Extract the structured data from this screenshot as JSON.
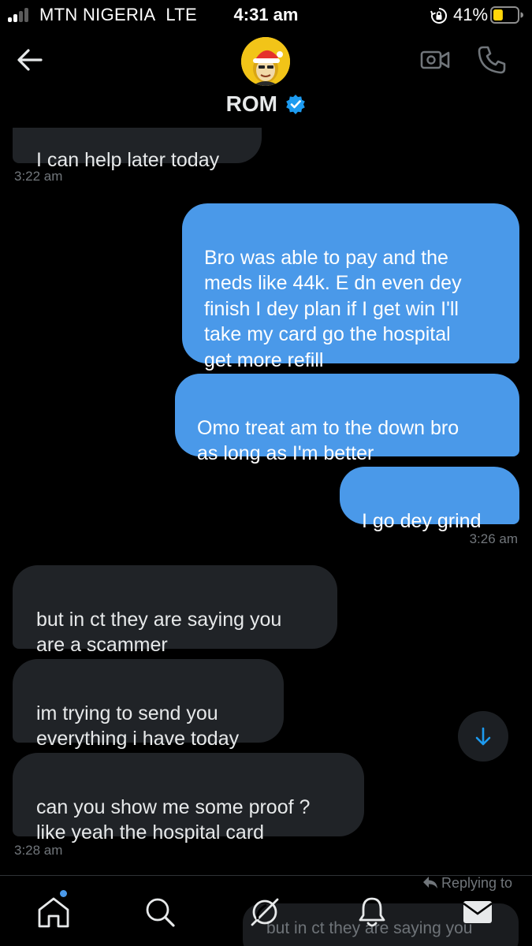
{
  "status_bar": {
    "carrier": "MTN NIGERIA",
    "network": "LTE",
    "time": "4:31 am",
    "battery_percent": "41%",
    "signal_strength_bars": 2,
    "battery_level": 0.41
  },
  "header": {
    "contact_name": "ROM",
    "verified": true
  },
  "messages": [
    {
      "direction": "received",
      "text": "I can help later today",
      "partially_visible": true
    },
    {
      "timestamp": "3:22 am"
    },
    {
      "direction": "sent",
      "text": "Bro was able to pay and the\nmeds like 44k. E dn even dey\nfinish I dey plan if I get win I'll\ntake my card go the hospital\nget more refill"
    },
    {
      "direction": "sent",
      "text": "Omo treat am to the down bro\nas long as I'm better"
    },
    {
      "direction": "sent",
      "text": "I go dey grind"
    },
    {
      "timestamp": "3:26 am"
    },
    {
      "direction": "received",
      "text": "but in ct they are saying you\nare a scammer"
    },
    {
      "direction": "received",
      "text": "im trying to send you\neverything i have today"
    },
    {
      "direction": "received",
      "text": "can you show me some proof ?\nlike yeah the hospital card"
    },
    {
      "timestamp": "3:28 am"
    }
  ],
  "reply": {
    "label": "Replying to",
    "preview_text": "but in ct they are saying you"
  },
  "tab_bar": {
    "tabs": [
      "home-icon",
      "search-icon",
      "spaces-icon",
      "notifications-icon",
      "messages-icon"
    ],
    "home_has_new": true
  },
  "colors": {
    "background": "#000000",
    "sent_bubble": "#4a99e9",
    "received_bubble": "#202327",
    "timestamp": "#71767b",
    "accent": "#1d9bf0"
  }
}
